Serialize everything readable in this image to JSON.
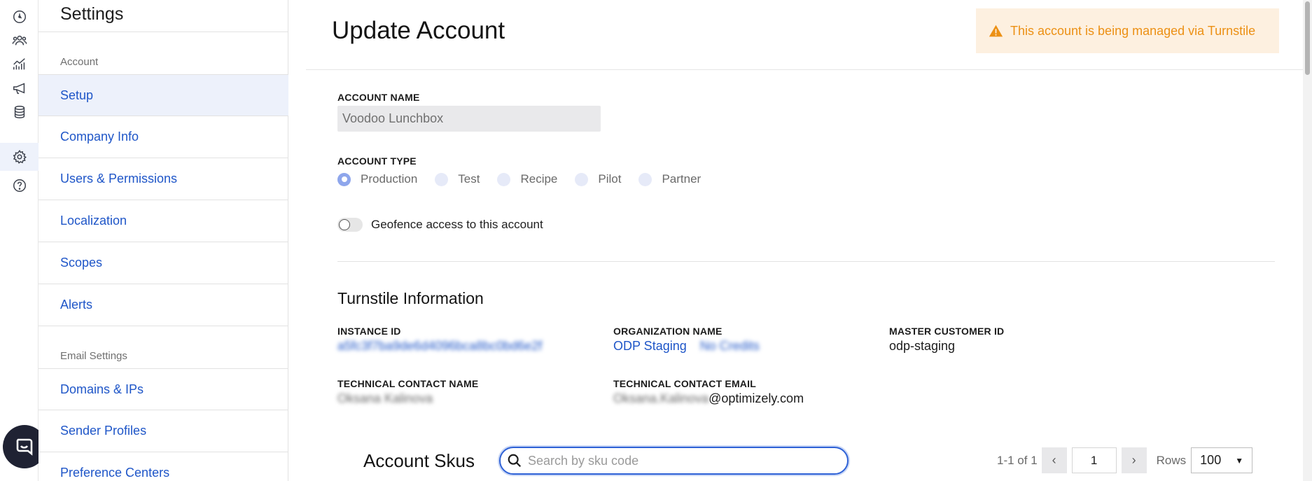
{
  "rail": {
    "icons": [
      "dashboard-icon",
      "people-icon",
      "analytics-icon",
      "megaphone-icon",
      "database-icon",
      "gear-icon",
      "help-icon"
    ],
    "active": "gear-icon"
  },
  "nav": {
    "title": "Settings",
    "sections": [
      {
        "label": "Account",
        "items": [
          {
            "label": "Setup",
            "active": true
          },
          {
            "label": "Company Info",
            "active": false
          },
          {
            "label": "Users & Permissions",
            "active": false
          },
          {
            "label": "Localization",
            "active": false
          },
          {
            "label": "Scopes",
            "active": false
          },
          {
            "label": "Alerts",
            "active": false
          }
        ]
      },
      {
        "label": "Email Settings",
        "items": [
          {
            "label": "Domains & IPs",
            "active": false
          },
          {
            "label": "Sender Profiles",
            "active": false
          },
          {
            "label": "Preference Centers",
            "active": false
          }
        ]
      }
    ]
  },
  "main": {
    "title": "Update Account",
    "banner": "This account is being managed via Turnstile",
    "account_name_label": "ACCOUNT NAME",
    "account_name_value": "Voodoo Lunchbox",
    "account_type_label": "ACCOUNT TYPE",
    "account_types": [
      {
        "label": "Production",
        "checked": true
      },
      {
        "label": "Test",
        "checked": false
      },
      {
        "label": "Recipe",
        "checked": false
      },
      {
        "label": "Pilot",
        "checked": false
      },
      {
        "label": "Partner",
        "checked": false
      }
    ],
    "geofence_label": "Geofence access to this account",
    "geofence_enabled": false
  },
  "turnstile": {
    "title": "Turnstile Information",
    "instance_id_label": "INSTANCE ID",
    "instance_id_value": "a5fc3f7ba9de6d4096bca8bc0bd6e2f",
    "org_name_label": "ORGANIZATION NAME",
    "org_name_value": "ODP Staging",
    "org_name_extra": "No Credits",
    "master_customer_id_label": "MASTER CUSTOMER ID",
    "master_customer_id_value": "odp-staging",
    "tech_contact_name_label": "TECHNICAL CONTACT NAME",
    "tech_contact_name_value": "Oksana Kalinova",
    "tech_contact_email_label": "TECHNICAL CONTACT EMAIL",
    "tech_contact_email_user": "Oksana.Kalinova",
    "tech_contact_email_domain": "@optimizely.com"
  },
  "skus": {
    "title": "Account Skus",
    "search_placeholder": "Search by sku code",
    "search_value": "",
    "count_text": "1-1 of 1",
    "prev_label": "‹",
    "next_label": "›",
    "page": "1",
    "rows_label": "Rows",
    "rows_value": "100"
  },
  "colors": {
    "link": "#1f56c8",
    "banner_bg": "#fdf0e0",
    "banner_text": "#ec9014",
    "active_nav_bg": "#edf1fb",
    "radio_checked": "#8ea6ec",
    "focus_ring": "#2f62d6"
  }
}
